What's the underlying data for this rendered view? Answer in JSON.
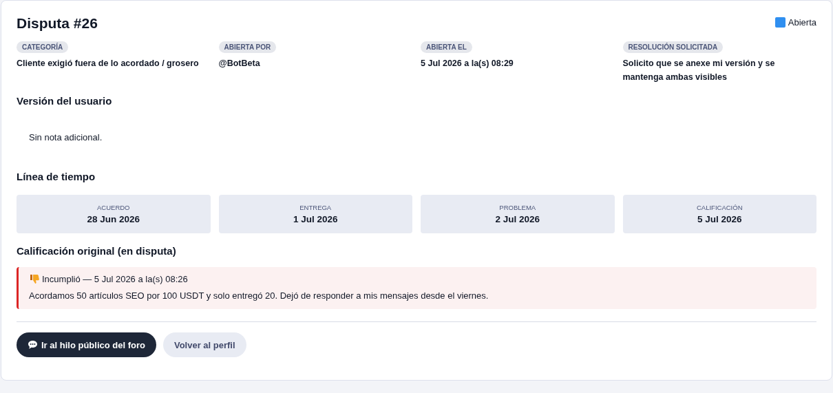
{
  "title": "Disputa #26",
  "status": {
    "label": "Abierta",
    "color": "#2f8ff0"
  },
  "meta": [
    {
      "label": "CATEGORÍA",
      "value": "Cliente exigió fuera de lo acordado / grosero"
    },
    {
      "label": "ABIERTA POR",
      "value": "@BotBeta"
    },
    {
      "label": "ABIERTA EL",
      "value": "5 Jul 2026 a la(s) 08:29"
    },
    {
      "label": "RESOLUCIÓN SOLICITADA",
      "value": "Solicito que se anexe mi versión y se mantenga ambas visibles"
    }
  ],
  "user_version": {
    "heading": "Versión del usuario",
    "note": "Sin nota adicional."
  },
  "timeline": {
    "heading": "Línea de tiempo",
    "steps": [
      {
        "label": "ACUERDO",
        "date": "28 Jun 2026"
      },
      {
        "label": "ENTREGA",
        "date": "1 Jul 2026"
      },
      {
        "label": "PROBLEMA",
        "date": "2 Jul 2026"
      },
      {
        "label": "CALIFICACIÓN",
        "date": "5 Jul 2026"
      }
    ]
  },
  "original_rating": {
    "heading": "Calificación original (en disputa)",
    "verdict": "Incumplió — 5 Jul 2026 a la(s) 08:26",
    "comment": "Acordamos 50 artículos SEO por 100 USDT y solo entregó 20. Dejó de responder a mis mensajes desde el viernes."
  },
  "buttons": [
    {
      "label": "Ir al hilo público del foro",
      "kind": "primary"
    },
    {
      "label": "Volver al perfil",
      "kind": "secondary"
    }
  ]
}
